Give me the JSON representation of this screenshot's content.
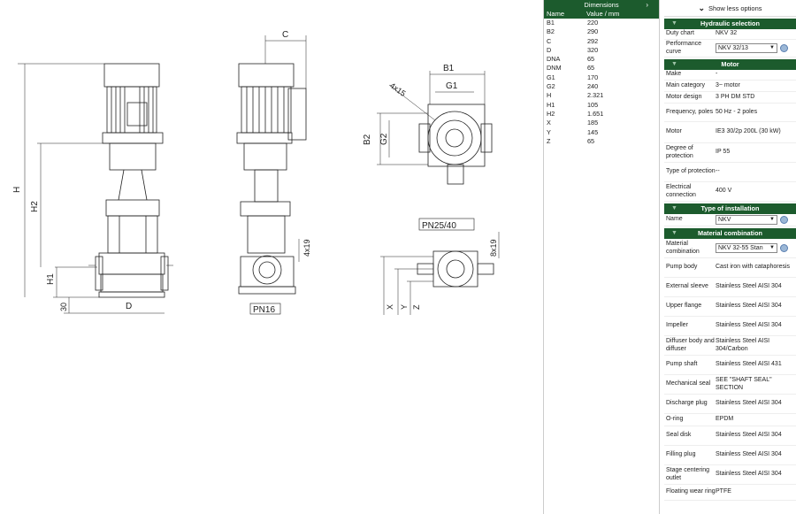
{
  "drawing": {
    "labels": {
      "C": "C",
      "B1": "B1",
      "G1": "G1",
      "H": "H",
      "H2": "H2",
      "H1": "H1",
      "D": "D",
      "thirty": "30",
      "B2": "B2",
      "G2": "G2",
      "fourx15": "4x15",
      "fourx19": "4x19",
      "eightx19": "8x19",
      "X": "X",
      "Y": "Y",
      "Z": "Z",
      "pn16": "PN16",
      "pn2540": "PN25/40"
    }
  },
  "dimensions": {
    "title": "Dimensions",
    "col_name": "Name",
    "col_value": "Value / mm",
    "rows": [
      {
        "name": "B1",
        "value": "220"
      },
      {
        "name": "B2",
        "value": "290"
      },
      {
        "name": "C",
        "value": "292"
      },
      {
        "name": "D",
        "value": "320"
      },
      {
        "name": "DNA",
        "value": "65"
      },
      {
        "name": "DNM",
        "value": "65"
      },
      {
        "name": "G1",
        "value": "170"
      },
      {
        "name": "G2",
        "value": "240"
      },
      {
        "name": "H",
        "value": "2.321"
      },
      {
        "name": "H1",
        "value": "105"
      },
      {
        "name": "H2",
        "value": "1.651"
      },
      {
        "name": "X",
        "value": "185"
      },
      {
        "name": "Y",
        "value": "145"
      },
      {
        "name": "Z",
        "value": "65"
      }
    ]
  },
  "panel": {
    "show_less": "Show less options",
    "hydraulic": {
      "title": "Hydraulic selection",
      "duty_chart_label": "Duty chart",
      "duty_chart_value": "NKV 32",
      "perf_label": "Performance curve",
      "perf_value": "NKV 32/13"
    },
    "motor": {
      "title": "Motor",
      "make_label": "Make",
      "make_value": "-",
      "maincat_label": "Main category",
      "maincat_value": "3~ motor",
      "design_label": "Motor design",
      "design_value": "3 PH DM STD",
      "freq_label": "Frequency, poles",
      "freq_value": "50 Hz - 2 poles",
      "motor_label": "Motor",
      "motor_value": "IE3 30/2p 200L (30 kW)",
      "degree_label": "Degree of protection",
      "degree_value": "IP 55",
      "type_label": "Type of protection",
      "type_value": "--",
      "elec_label": "Electrical connection",
      "elec_value": "400 V"
    },
    "installation": {
      "title": "Type of installation",
      "name_label": "Name",
      "name_value": "NKV"
    },
    "material": {
      "title": "Material combination",
      "combo_label": "Material combination",
      "combo_value": "NKV 32-55 Stan",
      "rows": [
        {
          "label": "Pump body",
          "value": "Cast iron with cataphoresis"
        },
        {
          "label": "External sleeve",
          "value": "Stainless Steel AISI 304"
        },
        {
          "label": "Upper flange",
          "value": "Stainless Steel AISI 304"
        },
        {
          "label": "Impeller",
          "value": "Stainless Steel AISI 304"
        },
        {
          "label": "Diffuser body and diffuser",
          "value": "Stainless Steel AISI 304/Carbon"
        },
        {
          "label": "Pump shaft",
          "value": "Stainless Steel AISI 431"
        },
        {
          "label": "Mechanical seal",
          "value": "SEE \"SHAFT SEAL\" SECTION"
        },
        {
          "label": "Discharge plug",
          "value": "Stainless Steel AISI 304"
        },
        {
          "label": "O-ring",
          "value": "EPDM"
        },
        {
          "label": "Seal disk",
          "value": "Stainless Steel AISI 304"
        },
        {
          "label": "Filling plug",
          "value": "Stainless Steel AISI 304"
        },
        {
          "label": "Stage centering outlet",
          "value": "Stainless Steel AISI 304"
        },
        {
          "label": "Floating wear ring",
          "value": "PTFE"
        }
      ]
    }
  }
}
